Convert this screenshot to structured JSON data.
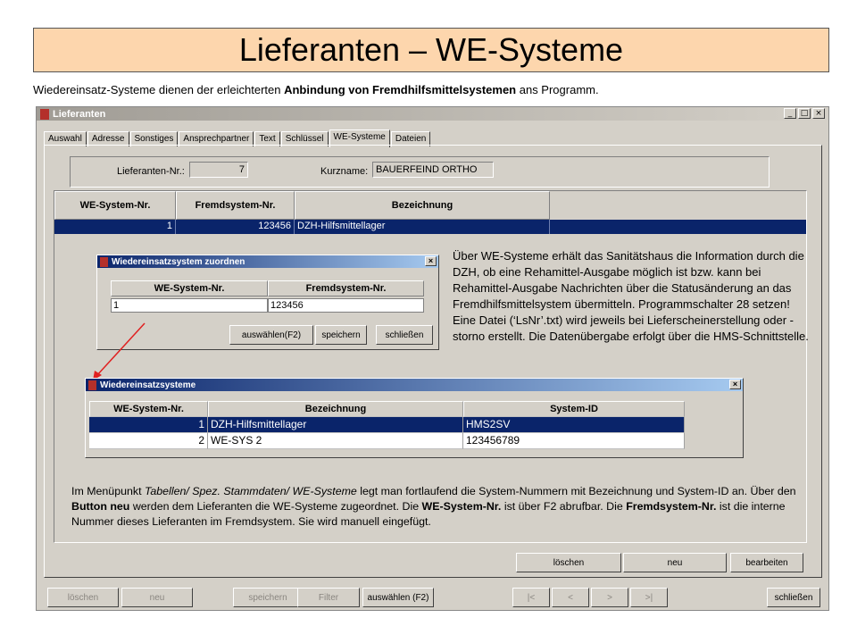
{
  "slide": {
    "title": "Lieferanten  – WE-Systeme",
    "subtitle_pre": "Wiedereinsatz-Systeme dienen der erleichterten ",
    "subtitle_bold": "Anbindung von Fremdhilfsmittelsystemen",
    "subtitle_post": "  ans Programm."
  },
  "window": {
    "title": "Lieferanten",
    "controls": [
      "_",
      "□",
      "×"
    ],
    "tabs": [
      "Auswahl",
      "Adresse",
      "Sonstiges",
      "Ansprechpartner",
      "Text",
      "Schlüssel",
      "WE-Systeme",
      "Dateien"
    ],
    "active_tab": "WE-Systeme",
    "lieferant_label": "Lieferanten-Nr.:",
    "lieferant_value": "7",
    "kurzname_label": "Kurzname:",
    "kurzname_value": "BAUERFEIND ORTHO",
    "grid": {
      "columns": [
        "WE-System-Nr.",
        "Fremdsystem-Nr.",
        "Bezeichnung"
      ],
      "rows": [
        [
          "1",
          "123456",
          "DZH-Hilfsmittellager"
        ]
      ]
    },
    "panel_buttons": [
      "löschen",
      "neu",
      "bearbeiten"
    ],
    "bottom_buttons": [
      "löschen",
      "neu",
      "speichern",
      "Filter",
      "auswählen (F2)",
      "|<",
      "<",
      ">",
      ">|",
      "schließen"
    ]
  },
  "dialog_assign": {
    "title": "Wiedereinsatzsystem zuordnen",
    "columns": [
      "WE-System-Nr.",
      "Fremdsystem-Nr."
    ],
    "values": [
      "1",
      "123456"
    ],
    "buttons": [
      "auswählen(F2)",
      "speichern",
      "schließen"
    ]
  },
  "dialog_list": {
    "title": "Wiedereinsatzsysteme",
    "columns": [
      "WE-System-Nr.",
      "Bezeichnung",
      "System-ID"
    ],
    "rows": [
      [
        "1",
        "DZH-Hilfsmittellager",
        "HMS2SV"
      ],
      [
        "2",
        "WE-SYS 2",
        "123456789"
      ]
    ]
  },
  "info": {
    "text": "Über WE-Systeme erhält das Sanitätshaus die Information durch die DZH, ob eine Rehamittel-Ausgabe möglich ist bzw. kann bei Rehamittel-Ausgabe Nachrichten über die Statusänderung an das Fremdhilfsmittelsystem übermitteln. Programmschalter 28 setzen! Eine Datei (‘LsNr’.txt) wird jeweils bei Lieferscheinerstellung oder -storno erstellt. Die Datenübergabe erfolgt über die HMS-Schnittstelle."
  },
  "bottom_note": {
    "p1": "Im Menüpunkt ",
    "p2_italic": "Tabellen/ Spez. Stammdaten/ WE-Systeme",
    "p3": " legt man fortlaufend die System-Nummern mit Bezeichnung und System-ID an. Über den ",
    "p4_bold": "Button neu",
    "p5": " werden dem Lieferanten die WE-Systeme zugeordnet. Die ",
    "p6_bold": "WE-System-Nr.",
    "p7": " ist über F2 abrufbar. Die ",
    "p8_bold": "Fremdsystem-Nr.",
    "p9": " ist die interne Nummer dieses Lieferanten im Fremdsystem. Sie wird manuell eingefügt."
  },
  "colors": {
    "title_bg": "#fdd6ad",
    "selection": "#0a246a",
    "window_bg": "#d4d0c8",
    "arrow": "#e02020"
  }
}
